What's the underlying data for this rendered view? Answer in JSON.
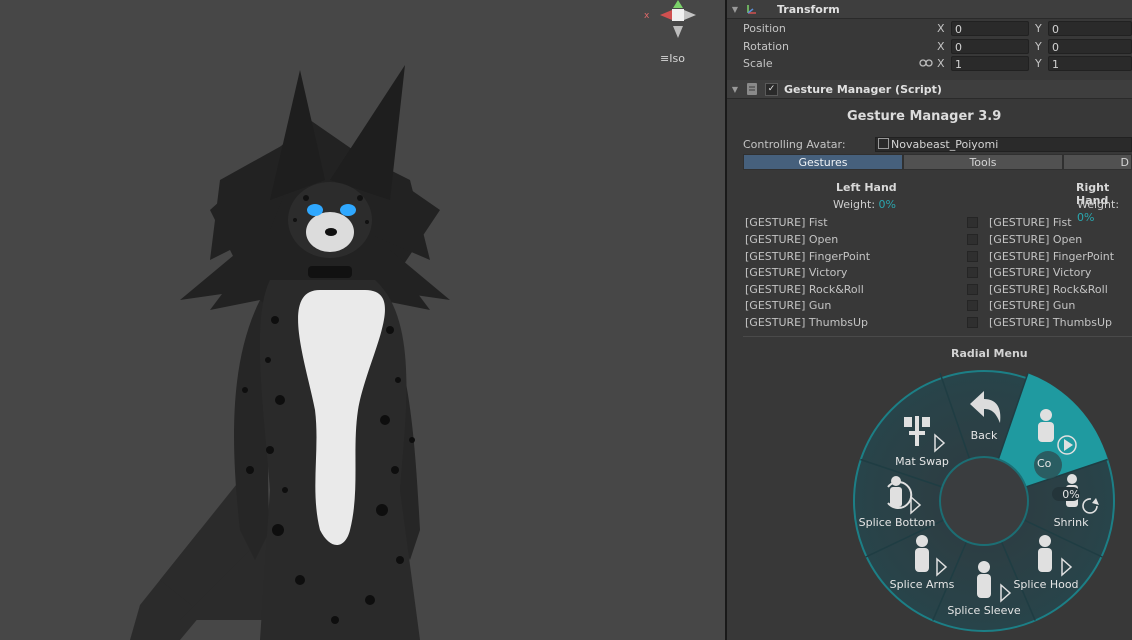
{
  "scene": {
    "gizmo_axis": "x",
    "projection_label": "Iso",
    "icons": {
      "menu": "hamburger-icon"
    }
  },
  "transform": {
    "title": "Transform",
    "position": {
      "label": "Position",
      "x": "0",
      "y": "0"
    },
    "rotation": {
      "label": "Rotation",
      "x": "0",
      "y": "0"
    },
    "scale": {
      "label": "Scale",
      "x": "1",
      "y": "1"
    },
    "axis_x": "X",
    "axis_y": "Y"
  },
  "gesture_manager": {
    "header": "Gesture Manager (Script)",
    "enabled": true,
    "title": "Gesture Manager 3.9",
    "controlling_label": "Controlling Avatar:",
    "controlling_value": "Novabeast_Poiyomi",
    "tabs": [
      {
        "label": "Gestures",
        "active": true
      },
      {
        "label": "Tools",
        "active": false
      },
      {
        "label": "D",
        "active": false
      }
    ],
    "left_hand": {
      "title": "Left Hand",
      "weight_label": "Weight:",
      "weight_value": "0%"
    },
    "right_hand": {
      "title": "Right Hand",
      "weight_label": "Weight:",
      "weight_value": "0%"
    },
    "gestures": [
      "[GESTURE] Fist",
      "[GESTURE] Open",
      "[GESTURE] FingerPoint",
      "[GESTURE] Victory",
      "[GESTURE] Rock&Roll",
      "[GESTURE] Gun",
      "[GESTURE] ThumbsUp"
    ],
    "radial_title": "Radial Menu",
    "radial_items": {
      "back": "Back",
      "top_right": "Co",
      "shrink": "Shrink",
      "shrink_value": "0%",
      "splice_hood": "Splice Hood",
      "splice_sleeve": "Splice Sleeve",
      "splice_arms": "Splice Arms",
      "splice_bottom": "Splice Bottom",
      "mat_swap": "Mat Swap"
    },
    "accent_color": "#1f9aa0"
  }
}
